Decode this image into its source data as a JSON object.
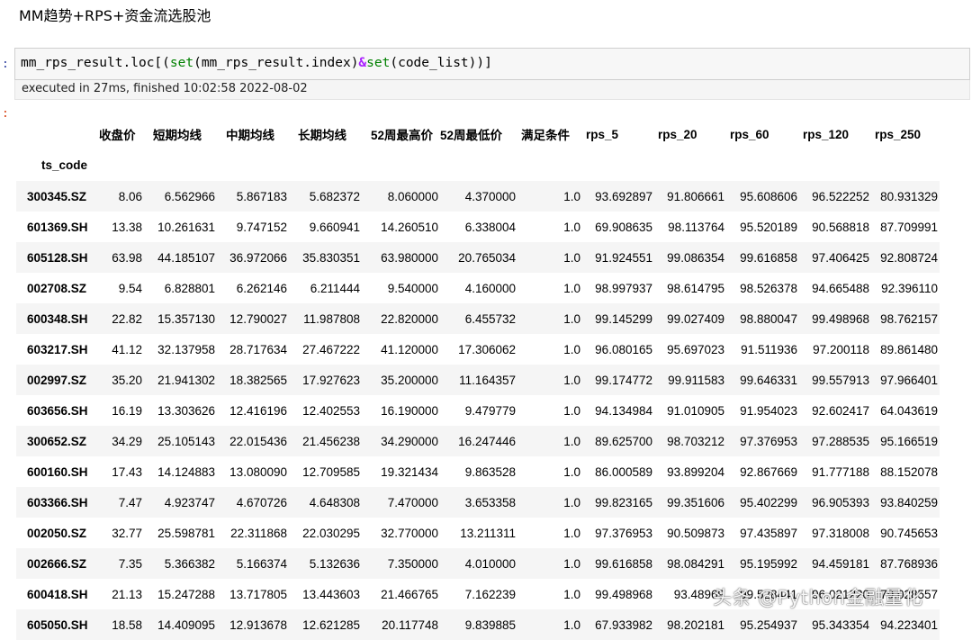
{
  "notebook": {
    "heading": "MM趋势+RPS+资金流选股池",
    "input_prompt": ":",
    "output_prompt": ":",
    "code": {
      "var1": "mm_rps_result",
      "dot_loc": ".loc",
      "open": "[(",
      "set1": "set",
      "arg1": "(mm_rps_result.index)",
      "amp": "&",
      "set2": "set",
      "arg2": "(code_list)",
      "close": ")]"
    },
    "exec_info": "executed in 27ms, finished 10:02:58 2022-08-02"
  },
  "table": {
    "index_name": "ts_code",
    "columns": [
      "收盘价",
      "短期均线",
      "中期均线",
      "长期均线",
      "52周最高价",
      "52周最低价",
      "满足条件",
      "rps_5",
      "rps_20",
      "rps_60",
      "rps_120",
      "rps_250"
    ],
    "rows": [
      [
        "300345.SZ",
        "8.06",
        "6.562966",
        "5.867183",
        "5.682372",
        "8.060000",
        "4.370000",
        "1.0",
        "93.692897",
        "91.806661",
        "95.608606",
        "96.522252",
        "80.931329"
      ],
      [
        "601369.SH",
        "13.38",
        "10.261631",
        "9.747152",
        "9.660941",
        "14.260510",
        "6.338004",
        "1.0",
        "69.908635",
        "98.113764",
        "95.520189",
        "90.568818",
        "87.709991"
      ],
      [
        "605128.SH",
        "63.98",
        "44.185107",
        "36.972066",
        "35.830351",
        "63.980000",
        "20.765034",
        "1.0",
        "91.924551",
        "99.086354",
        "99.616858",
        "97.406425",
        "92.808724"
      ],
      [
        "002708.SZ",
        "9.54",
        "6.828801",
        "6.262146",
        "6.211444",
        "9.540000",
        "4.160000",
        "1.0",
        "98.997937",
        "98.614795",
        "98.526378",
        "94.665488",
        "92.396110"
      ],
      [
        "600348.SH",
        "22.82",
        "15.357130",
        "12.790027",
        "11.987808",
        "22.820000",
        "6.455732",
        "1.0",
        "99.145299",
        "99.027409",
        "98.880047",
        "99.498968",
        "98.762157"
      ],
      [
        "603217.SH",
        "41.12",
        "32.137958",
        "28.717634",
        "27.467222",
        "41.120000",
        "17.306062",
        "1.0",
        "96.080165",
        "95.697023",
        "91.511936",
        "97.200118",
        "89.861480"
      ],
      [
        "002997.SZ",
        "35.20",
        "21.941302",
        "18.382565",
        "17.927623",
        "35.200000",
        "11.164357",
        "1.0",
        "99.174772",
        "99.911583",
        "99.646331",
        "99.557913",
        "97.966401"
      ],
      [
        "603656.SH",
        "16.19",
        "13.303626",
        "12.416196",
        "12.402553",
        "16.190000",
        "9.479779",
        "1.0",
        "94.134984",
        "91.010905",
        "91.954023",
        "92.602417",
        "64.043619"
      ],
      [
        "300652.SZ",
        "34.29",
        "25.105143",
        "22.015436",
        "21.456238",
        "34.290000",
        "16.247446",
        "1.0",
        "89.625700",
        "98.703212",
        "97.376953",
        "97.288535",
        "95.166519"
      ],
      [
        "600160.SH",
        "17.43",
        "14.124883",
        "13.080090",
        "12.709585",
        "19.321434",
        "9.863528",
        "1.0",
        "86.000589",
        "93.899204",
        "92.867669",
        "91.777188",
        "88.152078"
      ],
      [
        "603366.SH",
        "7.47",
        "4.923747",
        "4.670726",
        "4.648308",
        "7.470000",
        "3.653358",
        "1.0",
        "99.823165",
        "99.351606",
        "95.402299",
        "96.905393",
        "93.840259"
      ],
      [
        "002050.SZ",
        "32.77",
        "25.598781",
        "22.311868",
        "22.030295",
        "32.770000",
        "13.211311",
        "1.0",
        "97.376953",
        "90.509873",
        "97.435897",
        "97.318008",
        "90.745653"
      ],
      [
        "002666.SZ",
        "7.35",
        "5.366382",
        "5.166374",
        "5.132636",
        "7.350000",
        "4.010000",
        "1.0",
        "99.616858",
        "98.084291",
        "95.195992",
        "94.459181",
        "87.768936"
      ],
      [
        "600418.SH",
        "21.13",
        "15.247288",
        "13.717805",
        "13.443603",
        "21.466765",
        "7.162239",
        "1.0",
        "99.498968",
        "93.48969",
        "99.528441",
        "96.021220",
        "79.028557"
      ],
      [
        "605050.SH",
        "18.58",
        "14.409095",
        "12.913678",
        "12.621285",
        "20.117748",
        "9.839885",
        "1.0",
        "67.933982",
        "98.202181",
        "95.254937",
        "95.343354",
        "94.223401"
      ]
    ]
  },
  "watermark": "头条 @Python金融量化"
}
